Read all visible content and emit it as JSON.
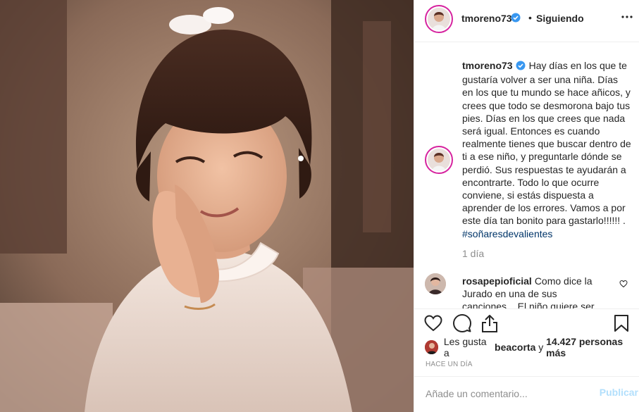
{
  "post": {
    "image": {
      "subject": "vintage-portrait-photo"
    },
    "header": {
      "username": "tmoreno73",
      "separator": "•",
      "follow_status": "Siguiendo",
      "more_icon": "ellipsis-icon"
    },
    "caption": {
      "username": "tmoreno73",
      "text": "Hay días en los que te gustaría volver a ser una niña. Días en los que tu mundo se hace añicos, y crees que todo se desmorona bajo tus pies. Días en los que crees que nada será igual. Entonces es cuando realmente tienes que buscar dentro de ti a ese niño, y preguntarle dónde se perdió. Sus respuestas te ayudarán a encontrarte. Todo lo que ocurre conviene, si estás dispuesta a aprender de los errores. Vamos a por este día tan bonito para gastarlo!!!!!! .",
      "hashtag": "#soñaresdevalientes",
      "time_ago": "1 día"
    },
    "comments": [
      {
        "username": "rosapepioficial",
        "text": "Como dice la Jurado en una de sus canciones... El niño quiere ser hombre, y..."
      }
    ],
    "actions": {
      "like_icon": "heart-icon",
      "comment_icon": "comment-icon",
      "share_icon": "share-icon",
      "save_icon": "bookmark-icon"
    },
    "likes": {
      "prefix": "Les gusta a",
      "user": "beacorta",
      "connector": "y",
      "count_text": "14.427 personas más"
    },
    "timestamp": "HACE UN DÍA",
    "comment_box": {
      "placeholder": "Añade un comentario...",
      "publish_label": "Publicar"
    },
    "colors": {
      "link_blue": "#003569",
      "verified_blue": "#3897f0",
      "publish_disabled": "#b2dffc",
      "muted": "#8e8e8e"
    }
  }
}
